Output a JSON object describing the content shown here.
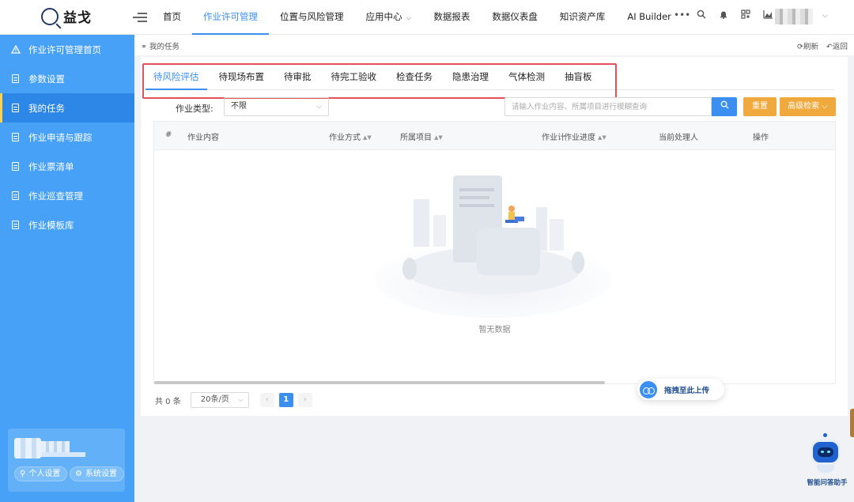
{
  "app": {
    "logo_text": "益戈",
    "logo_icon": "magnifier-logo-icon"
  },
  "topnav": {
    "items": [
      {
        "label": "首页",
        "active": false
      },
      {
        "label": "作业许可管理",
        "active": true
      },
      {
        "label": "位置与风险管理",
        "active": false
      },
      {
        "label": "应用中心",
        "active": false,
        "dropdown": true
      },
      {
        "label": "数据报表",
        "active": false
      },
      {
        "label": "数据仪表盘",
        "active": false
      },
      {
        "label": "知识资产库",
        "active": false
      },
      {
        "label": "AI Builder",
        "active": false
      }
    ],
    "icons": [
      "more-icon",
      "search-icon",
      "bell-icon",
      "qrcode-icon",
      "chart-icon"
    ]
  },
  "sidebar": {
    "items": [
      {
        "label": "作业许可管理首页",
        "icon": "warning-icon",
        "active": false
      },
      {
        "label": "参数设置",
        "icon": "document-icon",
        "active": false
      },
      {
        "label": "我的任务",
        "icon": "document-icon",
        "active": true
      },
      {
        "label": "作业申请与跟踪",
        "icon": "document-icon",
        "active": false
      },
      {
        "label": "作业票清单",
        "icon": "document-icon",
        "active": false
      },
      {
        "label": "作业巡查管理",
        "icon": "document-icon",
        "active": false
      },
      {
        "label": "作业模板库",
        "icon": "document-icon",
        "active": false
      }
    ],
    "user_card": {
      "personal_settings": "个人设置",
      "system_settings": "系统设置"
    }
  },
  "breadcrumb": {
    "current": "我的任务",
    "refresh": "刷新",
    "back": "返回"
  },
  "tabs": [
    {
      "label": "待风险评估",
      "active": true
    },
    {
      "label": "待现场布置",
      "active": false
    },
    {
      "label": "待审批",
      "active": false
    },
    {
      "label": "待完工验收",
      "active": false
    },
    {
      "label": "检查任务",
      "active": false
    },
    {
      "label": "隐患治理",
      "active": false
    },
    {
      "label": "气体检测",
      "active": false
    },
    {
      "label": "抽盲板",
      "active": false
    }
  ],
  "filters": {
    "type_label": "作业类型:",
    "type_value": "不限",
    "search_placeholder": "请输入作业内容、所属项目进行模糊查询",
    "reset": "重置",
    "advanced": "高级检索"
  },
  "table": {
    "columns": [
      {
        "label": "#",
        "sortable": false
      },
      {
        "label": "作业内容",
        "sortable": false
      },
      {
        "label": "作业方式",
        "sortable": true
      },
      {
        "label": "所属项目",
        "sortable": true
      },
      {
        "label": "作业计",
        "sortable": false
      },
      {
        "label": "作业进度",
        "sortable": true
      },
      {
        "label": "当前处理人",
        "sortable": false
      },
      {
        "label": "操作",
        "sortable": false
      }
    ],
    "rows": [],
    "empty_text": "暂无数据"
  },
  "pagination": {
    "total": "共 0 条",
    "page_size": "20条/页",
    "current_page": "1",
    "prev": "‹",
    "next": "›"
  },
  "floating": {
    "upload": "拖拽至此上传",
    "assistant": "智能问答助手"
  },
  "colors": {
    "primary": "#3b8ff0",
    "sidebar": "#46a1f7",
    "accent_orange": "#f0a93d",
    "highlight_red": "#e4505a"
  }
}
